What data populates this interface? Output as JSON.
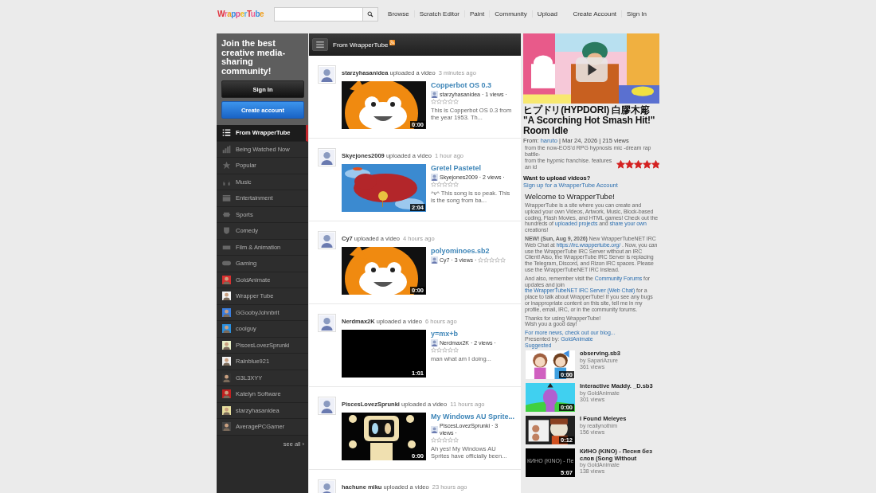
{
  "header": {
    "logo": "WrapperTube",
    "nav": [
      {
        "label": "Browse"
      },
      {
        "label": "Scratch Editor"
      },
      {
        "label": "Paint"
      },
      {
        "label": "Community"
      },
      {
        "label": "Upload"
      }
    ],
    "account": [
      {
        "label": "Create Account"
      },
      {
        "label": "Sign In"
      }
    ]
  },
  "sidebar": {
    "promo": "Join the best creative media-sharing community!",
    "sign_in": "Sign In",
    "create_account": "Create account",
    "see_all": "see all ›",
    "items": [
      {
        "kind": "category",
        "label": "From WrapperTube",
        "selected": true
      },
      {
        "kind": "category",
        "label": "Being Watched Now",
        "selected": false
      },
      {
        "kind": "category",
        "label": "Popular",
        "selected": false
      },
      {
        "kind": "category",
        "label": "Music",
        "selected": false
      },
      {
        "kind": "category",
        "label": "Entertainment",
        "selected": false
      },
      {
        "kind": "category",
        "label": "Sports",
        "selected": false
      },
      {
        "kind": "category",
        "label": "Comedy",
        "selected": false
      },
      {
        "kind": "category",
        "label": "Film & Animation",
        "selected": false
      },
      {
        "kind": "category",
        "label": "Gaming",
        "selected": false
      },
      {
        "kind": "channel",
        "label": "GoldAnimate",
        "selected": false
      },
      {
        "kind": "channel",
        "label": "Wrapper Tube",
        "selected": false
      },
      {
        "kind": "channel",
        "label": "GGoobyJohnbrit",
        "selected": false
      },
      {
        "kind": "channel",
        "label": "coolguy",
        "selected": false
      },
      {
        "kind": "channel",
        "label": "PiscesLovezSprunki",
        "selected": false
      },
      {
        "kind": "channel",
        "label": "Rainblue921",
        "selected": false
      },
      {
        "kind": "channel",
        "label": "G3L3XYY",
        "selected": false
      },
      {
        "kind": "channel",
        "label": "Katelyn Software",
        "selected": false
      },
      {
        "kind": "channel",
        "label": "starzyhasanidea",
        "selected": false
      },
      {
        "kind": "channel",
        "label": "AveragePCGamer",
        "selected": false
      }
    ]
  },
  "feed": {
    "title": "From WrapperTube",
    "posts": [
      {
        "user": "starzyhasanidea",
        "action": "uploaded a video",
        "time": "3 minutes ago",
        "video": {
          "title": "Copperbot OS 0.3",
          "duration": "0:00",
          "meta": "starzyhasanidea · 1 views ·",
          "stars": 0,
          "description": "This is Copperbot OS 0.3 from the year 1953. Th..."
        }
      },
      {
        "user": "Skyejones2009",
        "action": "uploaded a video",
        "time": "1 hour ago",
        "video": {
          "title": "Gretel Pastetel",
          "duration": "2:04",
          "meta": "Skyejones2009 · 2 views ·",
          "stars": 0,
          "description": "^v^ This song is so peak. This is the song from ba..."
        }
      },
      {
        "user": "Cy7",
        "action": "uploaded a video",
        "time": "4 hours ago",
        "video": {
          "title": "polyominoes.sb2",
          "duration": "0:00",
          "meta": "Cy7 · 3 views ·",
          "stars": 0
        }
      },
      {
        "user": "Nerdmax2K",
        "action": "uploaded a video",
        "time": "6 hours ago",
        "video": {
          "title": "y=mx+b",
          "duration": "1:01",
          "meta": "Nerdmax2K · 2 views ·",
          "stars": 0,
          "description": "man what am I doing..."
        }
      },
      {
        "user": "PiscesLovezSprunki",
        "action": "uploaded a video",
        "time": "11 hours ago",
        "video": {
          "title": "My Windows AU Sprite...",
          "duration": "0:00",
          "meta": "PiscesLovezSprunki · 3 views ·",
          "stars": 0,
          "description": "Ah yes! My Windows AU Sprites have officially been..."
        }
      },
      {
        "user": "hachune miku",
        "action": "uploaded a video",
        "time": "23 hours ago"
      }
    ]
  },
  "featured": {
    "title": "ヒプドリ(HYPDORI) 白膠木簓 \"A Scorching Hot Smash Hit!\" Room Idle",
    "from_label": "From:",
    "author": "haruto",
    "meta": "| Mar 24, 2026 | 215 views",
    "description_lines": [
      "from the now-EOS'd RPG hypnosis mic -dream rap battle-",
      "from the hypmic franchise. features an id"
    ],
    "stars": 5
  },
  "upload": {
    "heading": "Want to upload videos?",
    "link": "Sign up for a WrapperTube Account"
  },
  "welcome": {
    "title": "Welcome to WrapperTube!",
    "paragraphs": [
      [
        {
          "kind": "text",
          "text": "WrapperTube is a site where you can create and upload your own Videos, Artwork, Music, Block-based coding, Flash Movies, and HTML games! Check out the hundreds of"
        },
        {
          "kind": "link",
          "text": "uploaded projects"
        },
        {
          "kind": "text",
          "text": "and"
        },
        {
          "kind": "link",
          "text": "share your own"
        },
        {
          "kind": "text",
          "text": "creations!"
        }
      ],
      [
        {
          "kind": "text",
          "text": "**NEW! (Sun, Aug 9, 2026)** New WrapperTubeNET IRC Web Chat at"
        },
        {
          "kind": "link",
          "text": "https://irc.wrappertube.org/"
        },
        {
          "kind": "text",
          "text": ". Now, you can use the WrapperTube IRC Server without an IRC Client! Also, the WrapperTube IRC Server is replacing the Telegram, Discord, and Rizon IRC spaces. Please use the WrapperTubeNET IRC Instead."
        }
      ],
      [
        {
          "kind": "text",
          "text": "And also, remember visit the"
        },
        {
          "kind": "link",
          "text": "Community Forums"
        },
        {
          "kind": "text",
          "text": "for updates and join"
        },
        {
          "kind": "link",
          "text": "the WrapperTubeNET IRC Server (Web Chat)"
        },
        {
          "kind": "text",
          "text": "for a place to talk about WrapperTube! If you see any bugs or inappropriate content on this site, tell me in my profile, email, IRC, or in the community forums."
        }
      ],
      [
        {
          "kind": "text",
          "text": "Thanks for using WrapperTube!"
        },
        {
          "kind": "break"
        },
        {
          "kind": "text",
          "text": "Wish you a good day!"
        }
      ]
    ],
    "more_link": "For more news, check out our blog...",
    "presented_label": "Presented by:",
    "presenter": "GoldAnimate"
  },
  "suggested": {
    "label": "Suggested",
    "videos": [
      {
        "title": "observing.sb3",
        "by": "by SapariAzure",
        "views": "361 views",
        "duration": "0:00"
      },
      {
        "title": "Interactive Maddy. _D.sb3",
        "by": "by GoldAnimate",
        "views": "301 views",
        "duration": "0:00"
      },
      {
        "title": "I Found Meleyes",
        "by": "by reallynothim",
        "views": "156 views",
        "duration": "0:12"
      },
      {
        "title": "КИНО (KINO) - Песня без слов (Song Without",
        "by": "by GoldAnimate",
        "views": "138 views",
        "duration": "5:07",
        "alt_text": "КИНО (KINO) - Пе"
      }
    ]
  }
}
